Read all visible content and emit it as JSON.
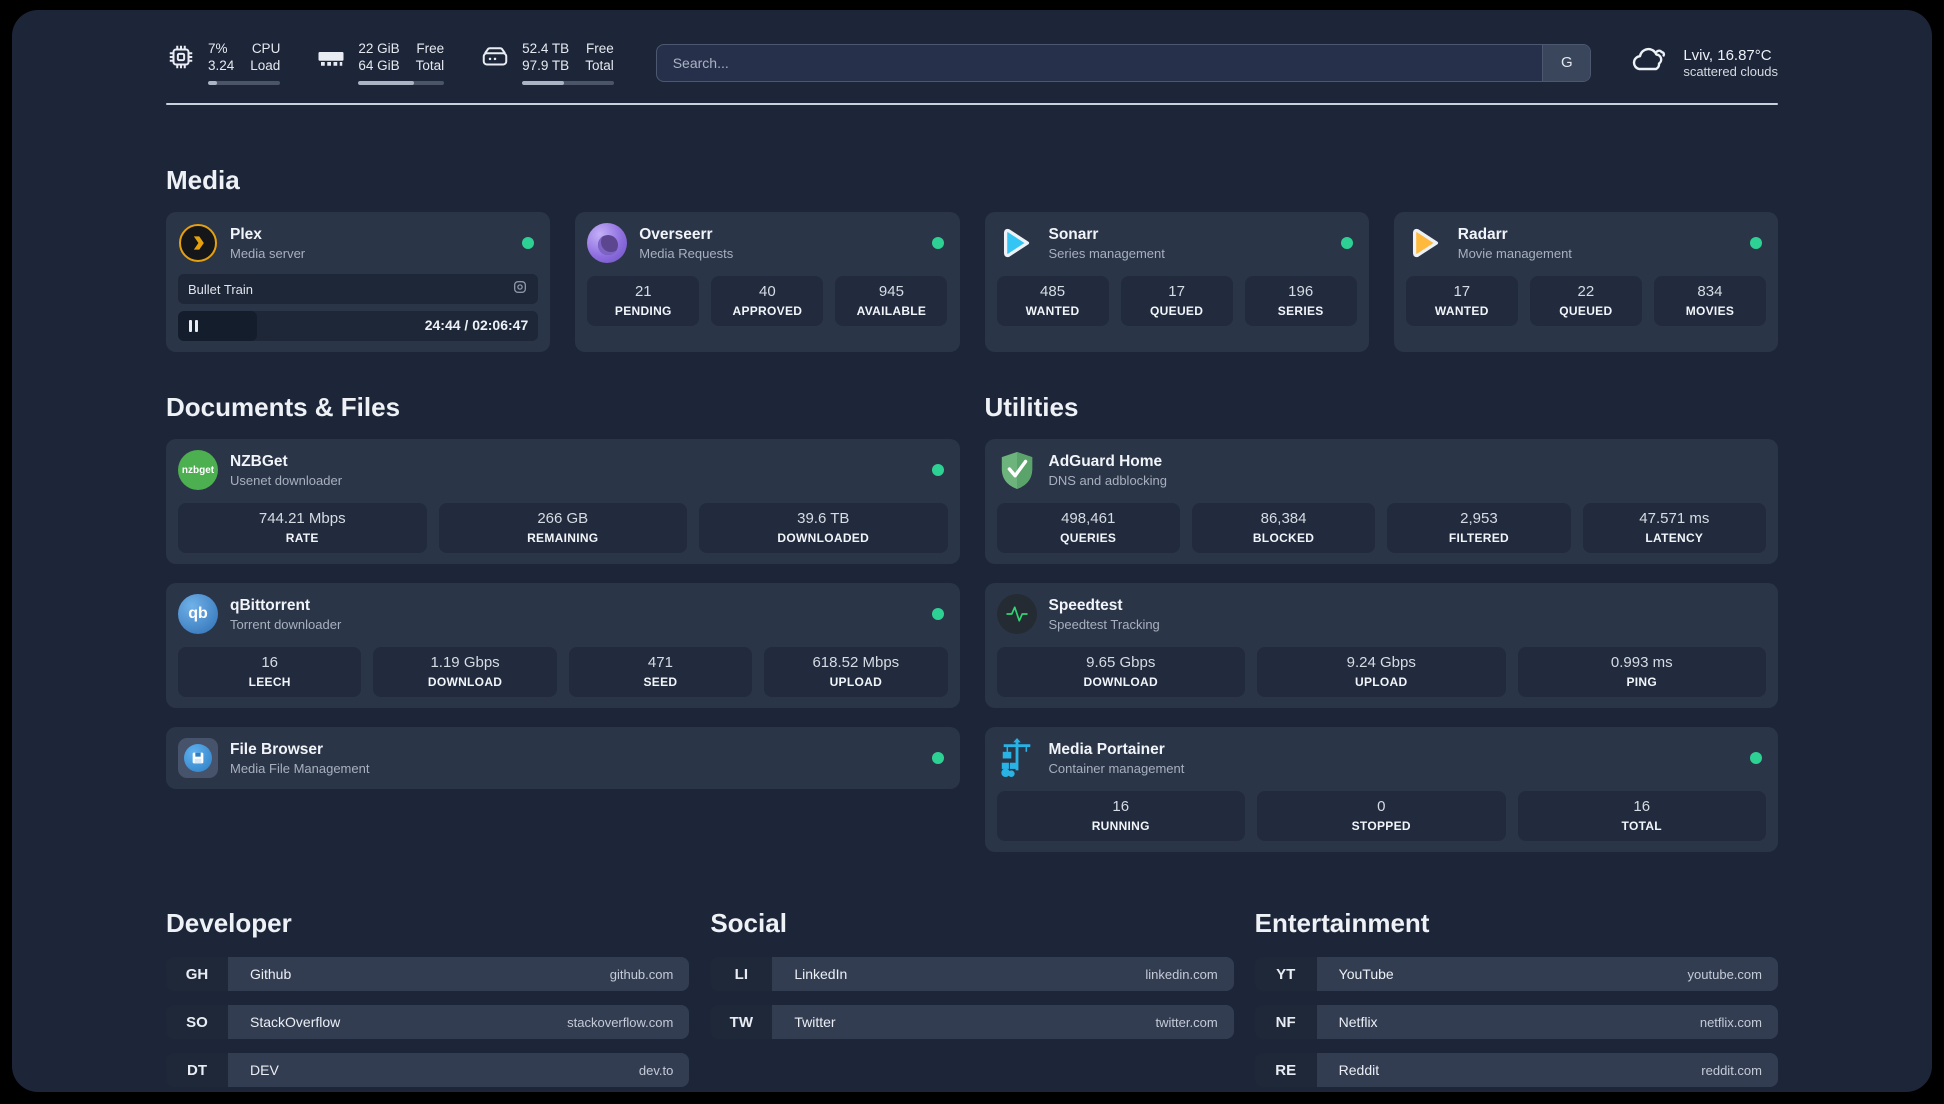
{
  "topbar": {
    "stats": [
      {
        "id": "cpu",
        "icon": "cpu-chip-icon",
        "values": [
          "7%",
          "3.24"
        ],
        "labels": [
          "CPU",
          "Load"
        ],
        "progress_percent": 12
      },
      {
        "id": "memory",
        "icon": "memory-ram-icon",
        "values": [
          "22 GiB",
          "64 GiB"
        ],
        "labels": [
          "Free",
          "Total"
        ],
        "progress_percent": 65
      },
      {
        "id": "disk",
        "icon": "hard-drive-icon",
        "values": [
          "52.4 TB",
          "97.9 TB"
        ],
        "labels": [
          "Free",
          "Total"
        ],
        "progress_percent": 46
      }
    ],
    "search": {
      "placeholder": "Search...",
      "engine_button": "G"
    },
    "weather": {
      "icon": "cloud-icon",
      "location": "Lviv, 16.87°C",
      "condition": "scattered clouds"
    }
  },
  "sections": {
    "media": "Media",
    "documents": "Documents & Files",
    "utilities": "Utilities",
    "developer": "Developer",
    "social": "Social",
    "entertainment": "Entertainment"
  },
  "services": {
    "plex": {
      "name": "Plex",
      "subtitle": "Media server",
      "status": "online",
      "now_playing": {
        "title": "Bullet Train",
        "time": "24:44 / 02:06:47",
        "progress_percent": 22
      }
    },
    "overseerr": {
      "name": "Overseerr",
      "subtitle": "Media Requests",
      "status": "online",
      "stats": [
        {
          "value": "21",
          "label": "PENDING"
        },
        {
          "value": "40",
          "label": "APPROVED"
        },
        {
          "value": "945",
          "label": "AVAILABLE"
        }
      ]
    },
    "sonarr": {
      "name": "Sonarr",
      "subtitle": "Series management",
      "status": "online",
      "stats": [
        {
          "value": "485",
          "label": "WANTED"
        },
        {
          "value": "17",
          "label": "QUEUED"
        },
        {
          "value": "196",
          "label": "SERIES"
        }
      ]
    },
    "radarr": {
      "name": "Radarr",
      "subtitle": "Movie management",
      "status": "online",
      "stats": [
        {
          "value": "17",
          "label": "WANTED"
        },
        {
          "value": "22",
          "label": "QUEUED"
        },
        {
          "value": "834",
          "label": "MOVIES"
        }
      ]
    },
    "nzbget": {
      "name": "NZBGet",
      "subtitle": "Usenet downloader",
      "status": "online",
      "icon_text": "nzbget",
      "stats": [
        {
          "value": "744.21 Mbps",
          "label": "RATE"
        },
        {
          "value": "266 GB",
          "label": "REMAINING"
        },
        {
          "value": "39.6 TB",
          "label": "DOWNLOADED"
        }
      ]
    },
    "qbittorrent": {
      "name": "qBittorrent",
      "subtitle": "Torrent downloader",
      "status": "online",
      "icon_text": "qb",
      "stats": [
        {
          "value": "16",
          "label": "LEECH"
        },
        {
          "value": "1.19 Gbps",
          "label": "DOWNLOAD"
        },
        {
          "value": "471",
          "label": "SEED"
        },
        {
          "value": "618.52 Mbps",
          "label": "UPLOAD"
        }
      ]
    },
    "filebrowser": {
      "name": "File Browser",
      "subtitle": "Media File Management",
      "status": "online"
    },
    "adguard": {
      "name": "AdGuard Home",
      "subtitle": "DNS and adblocking",
      "stats": [
        {
          "value": "498,461",
          "label": "QUERIES"
        },
        {
          "value": "86,384",
          "label": "BLOCKED"
        },
        {
          "value": "2,953",
          "label": "FILTERED"
        },
        {
          "value": "47.571 ms",
          "label": "LATENCY"
        }
      ]
    },
    "speedtest": {
      "name": "Speedtest",
      "subtitle": "Speedtest Tracking",
      "stats": [
        {
          "value": "9.65 Gbps",
          "label": "DOWNLOAD"
        },
        {
          "value": "9.24 Gbps",
          "label": "UPLOAD"
        },
        {
          "value": "0.993 ms",
          "label": "PING"
        }
      ]
    },
    "portainer": {
      "name": "Media Portainer",
      "subtitle": "Container management",
      "status": "online",
      "stats": [
        {
          "value": "16",
          "label": "RUNNING"
        },
        {
          "value": "0",
          "label": "STOPPED"
        },
        {
          "value": "16",
          "label": "TOTAL"
        }
      ]
    }
  },
  "bookmarks": {
    "developer": [
      {
        "abbr": "GH",
        "name": "Github",
        "url": "github.com"
      },
      {
        "abbr": "SO",
        "name": "StackOverflow",
        "url": "stackoverflow.com"
      },
      {
        "abbr": "DT",
        "name": "DEV",
        "url": "dev.to"
      }
    ],
    "social": [
      {
        "abbr": "LI",
        "name": "LinkedIn",
        "url": "linkedin.com"
      },
      {
        "abbr": "TW",
        "name": "Twitter",
        "url": "twitter.com"
      }
    ],
    "entertainment": [
      {
        "abbr": "YT",
        "name": "YouTube",
        "url": "youtube.com"
      },
      {
        "abbr": "NF",
        "name": "Netflix",
        "url": "netflix.com"
      },
      {
        "abbr": "RE",
        "name": "Reddit",
        "url": "reddit.com"
      }
    ]
  },
  "colors": {
    "status_online": "#2dd193",
    "background": "#1d2638",
    "card": "#2b3548",
    "tile": "#212b3d",
    "plex_accent": "#e5a00d",
    "sonarr_accent": "#35c5f4",
    "radarr_accent": "#ffb93d",
    "nzbget_accent": "#4caf50",
    "qbittorrent_accent": "#3f87d4",
    "adguard_accent": "#67b279",
    "speedtest_accent": "#2fd673",
    "portainer_accent": "#29b2e4"
  }
}
